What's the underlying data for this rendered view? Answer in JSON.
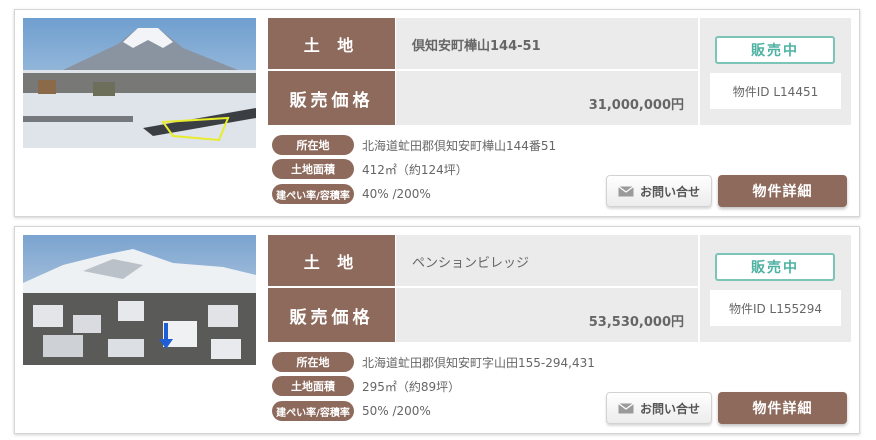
{
  "listings": [
    {
      "category": "土 地",
      "price_label": "販売価格",
      "address_title": "倶知安町樺山144-51",
      "price": "31,000,000円",
      "status": "販売中",
      "property_id": "物件ID L14451",
      "details": [
        {
          "label": "所在地",
          "value": "北海道虻田郡倶知安町樺山144番51"
        },
        {
          "label": "土地面積",
          "value": "412㎡（約124坪）"
        },
        {
          "label": "建ぺい率/容積率",
          "value": "40% /200%"
        }
      ],
      "contact_label": "お問い合せ",
      "detail_label": "物件詳細"
    },
    {
      "category": "土 地",
      "price_label": "販売価格",
      "address_title": "ペンションビレッジ",
      "price": "53,530,000円",
      "status": "販売中",
      "property_id": "物件ID L155294",
      "details": [
        {
          "label": "所在地",
          "value": "北海道虻田郡倶知安町字山田155-294,431"
        },
        {
          "label": "土地面積",
          "value": "295㎡（約89坪）"
        },
        {
          "label": "建ぺい率/容積率",
          "value": "50% /200%"
        }
      ],
      "contact_label": "お問い合せ",
      "detail_label": "物件詳細"
    }
  ],
  "colors": {
    "brand_brown": "#8d6a5c",
    "status_teal": "#4eb2a2",
    "cell_gray": "#ebebeb"
  },
  "icons": {
    "contact": "mail-icon"
  }
}
